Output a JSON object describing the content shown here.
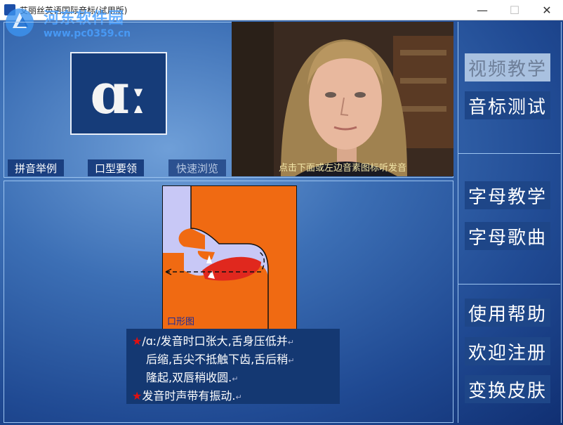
{
  "window": {
    "title": "艾丽丝英语国际音标(试用版)",
    "controls": {
      "minimize": "—",
      "maximize": "☐",
      "close": "✕"
    }
  },
  "watermark": {
    "line1": "河东软件园",
    "line2": "www.pc0359.cn"
  },
  "phonetic": {
    "symbol": "ɑː"
  },
  "top_buttons": [
    {
      "label": "拼音举例",
      "enabled": true
    },
    {
      "label": "口型要领",
      "enabled": true
    },
    {
      "label": "快速浏览",
      "enabled": false
    }
  ],
  "video": {
    "caption": "点击下面或左边音素图标听发音"
  },
  "mouth_diagram": {
    "label": "口形图"
  },
  "description": {
    "line1": "/ɑː/发音时口张大,舌身压低并",
    "line2": "后缩,舌尖不抵触下齿,舌后稍",
    "line3": "隆起,双唇稍收圆.",
    "line4": "发音时声带有振动.",
    "star": "★",
    "return_mark": "↵"
  },
  "side_menu": [
    {
      "label": "视频教学",
      "active": false
    },
    {
      "label": "音标测试",
      "active": true
    },
    {
      "label": "字母教学",
      "active": true
    },
    {
      "label": "字母歌曲",
      "active": true
    },
    {
      "label": "使用帮助",
      "active": true
    },
    {
      "label": "欢迎注册",
      "active": true
    },
    {
      "label": "变换皮肤",
      "active": true
    }
  ],
  "colors": {
    "accent": "#1e4688",
    "mouth_fill": "#f06a12",
    "tongue": "#e0281e",
    "star": "#e01010"
  }
}
